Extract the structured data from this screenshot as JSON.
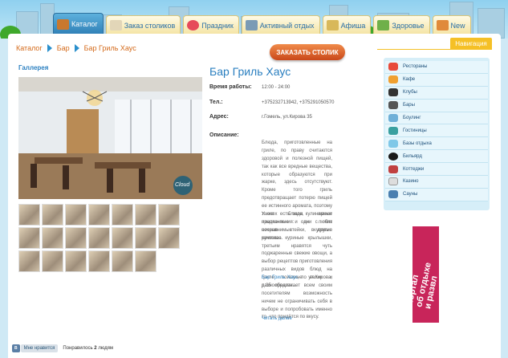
{
  "tabs": [
    {
      "label": "Каталог",
      "active": true
    },
    {
      "label": "Заказ столиков",
      "active": false
    },
    {
      "label": "Праздник",
      "active": false
    },
    {
      "label": "Активный отдых",
      "active": false
    },
    {
      "label": "Афиша",
      "active": false
    },
    {
      "label": "Здоровье",
      "active": false
    },
    {
      "label": "New",
      "active": false
    }
  ],
  "breadcrumb": [
    "Каталог",
    "Бар",
    "Бар Гриль Хаус"
  ],
  "order_button": "ЗАКАЗАТЬ СТОЛИК",
  "gallery_title": "Галлерея",
  "photo_watermark": "Cloud",
  "venue": {
    "title": "Бар Гриль Хаус",
    "hours_label": "Время работы:",
    "hours": "12:00 - 24:00",
    "phone_label": "Тел.:",
    "phone": "+375232713942, +375291050570",
    "address_label": "Адрес:",
    "address": "г.Гомель, ул.Кирова 35",
    "description_label": "Описание:",
    "desc_p1": "Блюда, приготовленные на гриле, по праву считаются здоровой и полезной пищей, так как все вредные вещества, которые образуются при жарке, здесь отсутствуют. Кроме того гриль предотвращает потерю пищей ее истинного аромата, поэтому такие блюда, имеют изысканные и ни с чем несравнимые вкусовые качества.",
    "desc_p2": "У всех есть свои кулинарные предпочтения: одни любят сочные стейки, другие румяные куриные крылышки, третьим нравятся чуть поджаренные свежие овощи, а выбор рецептов приготовления различных видов блюд на гриле поистине велик и разнообразен...",
    "desc_p3_link": "Бар Гриль Хаус",
    "desc_p3": ", по ул.Кирова, д.35 предлагает всем своим посетителям возможность ничем не ограничивать себя в выборе и попробовать именно то, что придётся по вкусу.",
    "read_more": "Читать далее"
  },
  "navigation": {
    "title": "Навигация",
    "items": [
      {
        "label": "Рестораны",
        "icon": "restaurant-icon",
        "color": "#e84a3a"
      },
      {
        "label": "Кафе",
        "icon": "cafe-icon",
        "color": "#f0a030"
      },
      {
        "label": "Клубы",
        "icon": "club-icon",
        "color": "#333333"
      },
      {
        "label": "Бары",
        "icon": "bar-icon",
        "color": "#555555"
      },
      {
        "label": "Боулинг",
        "icon": "bowling-icon",
        "color": "#6fb0d8"
      },
      {
        "label": "Гостиницы",
        "icon": "hotel-icon",
        "color": "#3aa0a0"
      },
      {
        "label": "Базы отдыха",
        "icon": "resort-icon",
        "color": "#7fc8e8"
      },
      {
        "label": "Бильярд",
        "icon": "billiard-icon",
        "color": "#1a1a1a"
      },
      {
        "label": "Коттеджи",
        "icon": "cottage-icon",
        "color": "#c04040"
      },
      {
        "label": "Казино",
        "icon": "casino-icon",
        "color": "#dddddd"
      },
      {
        "label": "Сауны",
        "icon": "sauna-icon",
        "color": "#4a7fb0"
      }
    ]
  },
  "banner": {
    "line1": "портал",
    "line2": "об отдыхе",
    "line3": "и развл"
  },
  "social": {
    "vk": "В",
    "like_button": "Мне нравится",
    "liked_prefix": "Понравилось",
    "liked_count": "2",
    "liked_suffix": "людям"
  }
}
